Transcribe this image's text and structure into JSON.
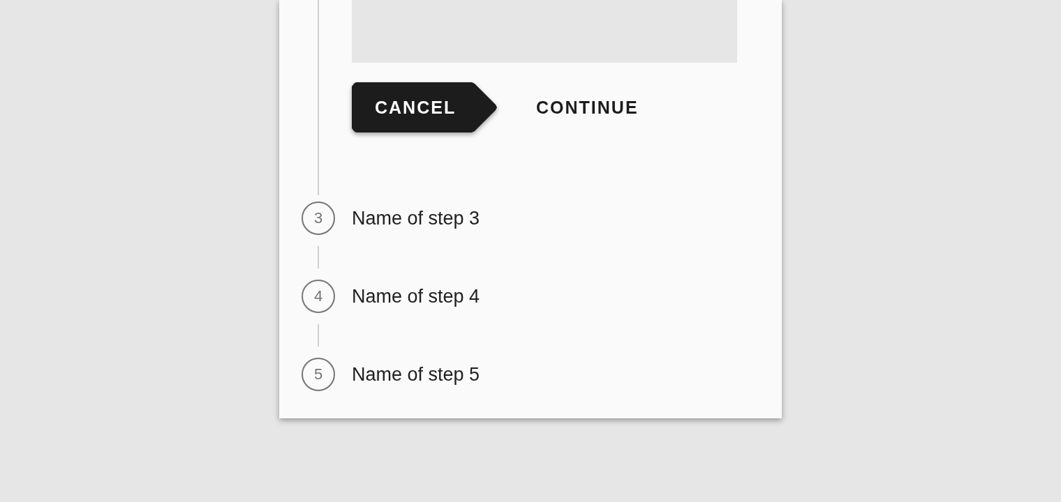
{
  "active_step": {
    "buttons": [
      {
        "label": "CANCEL",
        "kind": "filled"
      },
      {
        "label": "CONTINUE",
        "kind": "text"
      }
    ]
  },
  "steps": [
    {
      "number": "3",
      "label": "Name of step 3"
    },
    {
      "number": "4",
      "label": "Name of step 4"
    },
    {
      "number": "5",
      "label": "Name of step 5"
    }
  ]
}
